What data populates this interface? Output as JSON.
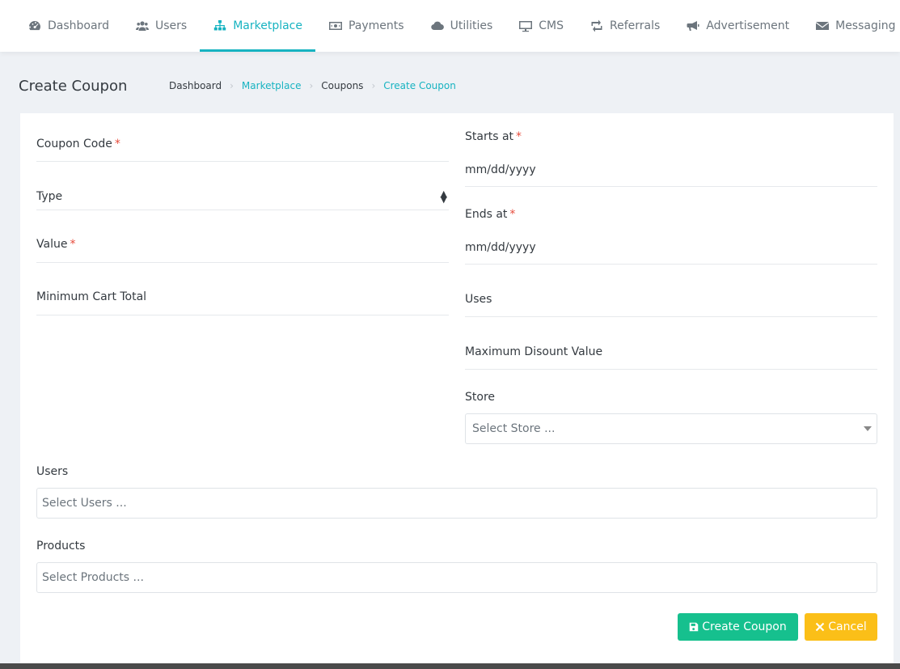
{
  "nav": {
    "items": [
      {
        "label": "Dashboard",
        "icon": "dashboard-icon"
      },
      {
        "label": "Users",
        "icon": "users-icon"
      },
      {
        "label": "Marketplace",
        "icon": "sitemap-icon",
        "active": true
      },
      {
        "label": "Payments",
        "icon": "money-icon"
      },
      {
        "label": "Utilities",
        "icon": "cloud-icon"
      },
      {
        "label": "CMS",
        "icon": "monitor-icon"
      },
      {
        "label": "Referrals",
        "icon": "retweet-icon"
      },
      {
        "label": "Advertisement",
        "icon": "bullhorn-icon"
      },
      {
        "label": "Messaging",
        "icon": "envelope-icon"
      }
    ]
  },
  "header": {
    "title": "Create Coupon",
    "breadcrumb": [
      "Dashboard",
      "Marketplace",
      "Coupons",
      "Create Coupon"
    ]
  },
  "form": {
    "coupon_code": {
      "label": "Coupon Code",
      "required": "*"
    },
    "type": {
      "label": "Type"
    },
    "value": {
      "label": "Value",
      "required": "*"
    },
    "min_cart": {
      "label": "Minimum Cart Total"
    },
    "starts_at": {
      "label": "Starts at",
      "required": "*",
      "value": "mm/dd/yyyy"
    },
    "ends_at": {
      "label": "Ends at",
      "required": "*",
      "value": "mm/dd/yyyy"
    },
    "uses": {
      "label": "Uses"
    },
    "max_discount": {
      "label": "Maximum Disount Value"
    },
    "store": {
      "label": "Store",
      "placeholder": "Select Store ..."
    },
    "users": {
      "label": "Users",
      "placeholder": "Select Users ..."
    },
    "products": {
      "label": "Products",
      "placeholder": "Select Products ..."
    }
  },
  "actions": {
    "create_label": "Create Coupon",
    "cancel_label": "Cancel"
  },
  "colors": {
    "accent": "#17b3c1",
    "success": "#16c08e",
    "warning": "#fbbf18",
    "required": "#e74c3c"
  }
}
